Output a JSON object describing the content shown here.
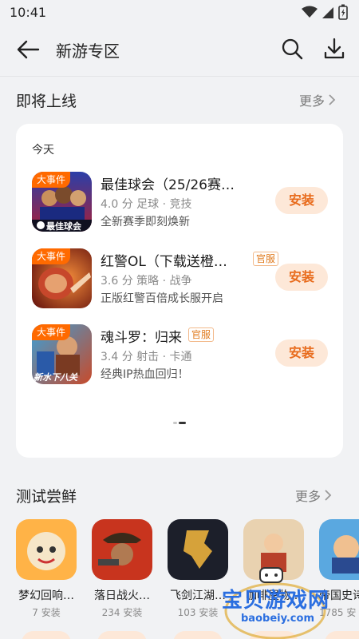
{
  "status": {
    "time": "10:41"
  },
  "header": {
    "title": "新游专区"
  },
  "upcoming": {
    "title": "即将上线",
    "more": "更多",
    "day": "今天",
    "games": [
      {
        "name": "最佳球会（25/26赛…",
        "tag": "大事件",
        "meta": "4.0 分 足球 · 竞技",
        "desc": "全新赛季即刻焕新",
        "button": "安装",
        "official": "",
        "icon_label": "最佳球会"
      },
      {
        "name": "红警OL（下载送橙…",
        "tag": "大事件",
        "meta": "3.6 分 策略 · 战争",
        "desc": "正版红警百倍成长服开启",
        "button": "安装",
        "official": "官服"
      },
      {
        "name": "魂斗罗：归来",
        "tag": "大事件",
        "meta": "3.4 分 射击 · 卡通",
        "desc": "经典IP热血回归！",
        "button": "安装",
        "official": "官服",
        "icon_label": "新水下八关"
      }
    ]
  },
  "test": {
    "title": "测试尝鲜",
    "more": "更多",
    "apps": [
      {
        "name": "梦幻回响…",
        "count": "7 安装"
      },
      {
        "name": "落日战火…",
        "count": "234 安装"
      },
      {
        "name": "飞剑江湖…",
        "count": "103 安装"
      },
      {
        "name": "咖啡屋物…",
        "count": ""
      },
      {
        "name": "帝国史诗",
        "count": "1785 安"
      }
    ]
  },
  "watermark": {
    "text": "宝贝游戏网",
    "url": "baobeiy.com"
  },
  "colors": {
    "accent": "#e86b1c",
    "button_bg": "#fde8d8",
    "event_tag": "#ff6a00"
  }
}
